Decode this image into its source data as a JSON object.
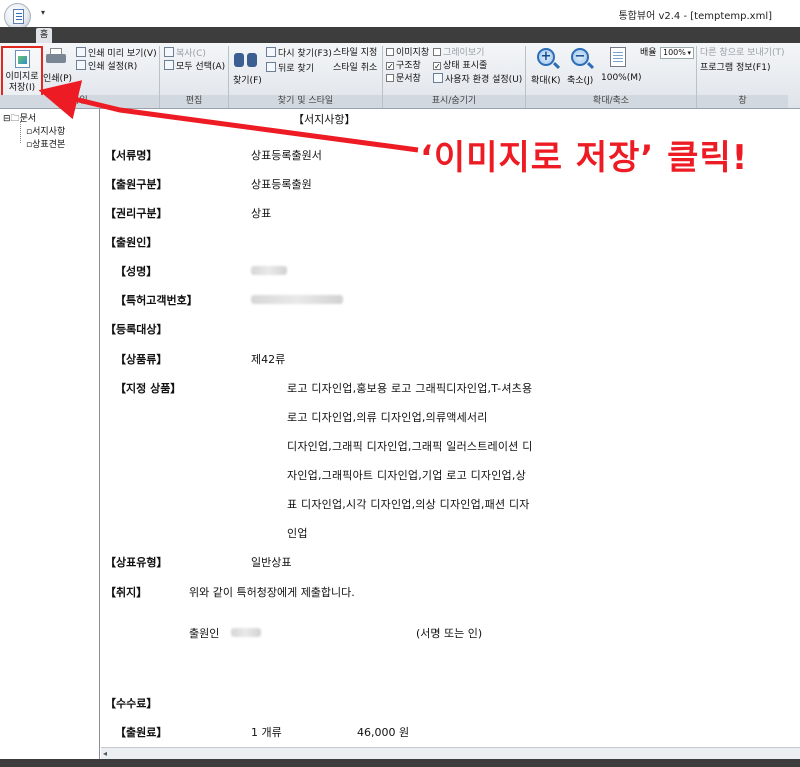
{
  "window": {
    "title": "통합뷰어 v2.4 - [temptemp.xml]",
    "qa_arrow": "▾"
  },
  "tabs": [
    {
      "label": "홈"
    }
  ],
  "ribbon": {
    "save_image": "이미지로 저장(I)",
    "print": "인쇄(P)",
    "print_preview": "인쇄 미리 보기(V)",
    "print_setup": "인쇄 설정(R)",
    "copy": "복사(C)",
    "select_all": "모두 선택(A)",
    "find": "찾기(F)",
    "find_again": "다시 찾기(F3)",
    "find_back": "뒤로 찾기",
    "style_set": "스타일 지정",
    "style_cancel": "스타일 취소",
    "image_window": "이미지창",
    "gray_view": "그레이보기",
    "structure_window": "구조창",
    "status_bar": "상태 표시줄",
    "doc_window": "문서창",
    "user_settings": "사용자 환경 설정(U)",
    "zoom_in": "확대(K)",
    "zoom_out": "축소(J)",
    "zoom_100": "100%(M)",
    "zoom_label": "배율",
    "zoom_value": "100%",
    "prev_window": "다른 창으로 보내기(T)",
    "program_info": "프로그램 정보(F1)",
    "groups": {
      "file": "파일",
      "edit": "편집",
      "find_style": "찾기 및 스타일",
      "show_hide": "표시/숨기기",
      "zoom": "확대/축소",
      "window": "창"
    }
  },
  "tree": {
    "root": "문서",
    "items": [
      "서지사항",
      "상표견본"
    ]
  },
  "doc": {
    "title": "【서지사항】",
    "fields": {
      "doc_name_label": "【서류명】",
      "doc_name": "상표등록출원서",
      "app_type_label": "【출원구분】",
      "app_type": "상표등록출원",
      "right_type_label": "【권리구분】",
      "right_type": "상표",
      "applicant_label": "【출원인】",
      "name_label": "【성명】",
      "code_label": "【특허고객번호】",
      "reg_target_label": "【등록대상】",
      "class_label": "【상품류】",
      "class_value": "제42류",
      "goods_label": "【지정 상품】",
      "goods_lines": [
        "로고 디자인업,홍보용 로고 그래픽디자인업,T-셔츠용",
        "로고 디자인업,의류 디자인업,의류액세서리",
        "디자인업,그래픽 디자인업,그래픽 일러스트레이션 디",
        "자인업,그래픽아트 디자인업,기업 로고 디자인업,상",
        "표 디자인업,시각 디자인업,의상 디자인업,패션 디자",
        "인업"
      ],
      "mark_type_label": "【상표유형】",
      "mark_type": "일반상표",
      "purpose_label": "【취지】",
      "purpose": "위와 같이 특허청장에게 제출합니다.",
      "applicant_sign_label": "출원인",
      "sign_note": "(서명 또는 인)",
      "fee_label": "【수수료】",
      "app_fee_label": "【출원료】",
      "app_fee_count": "1 개류",
      "app_fee_amount": "46,000 원"
    }
  },
  "annotation": {
    "text": "‘이미지로 저장’ 클릭!",
    "color": "#ed1c24"
  }
}
